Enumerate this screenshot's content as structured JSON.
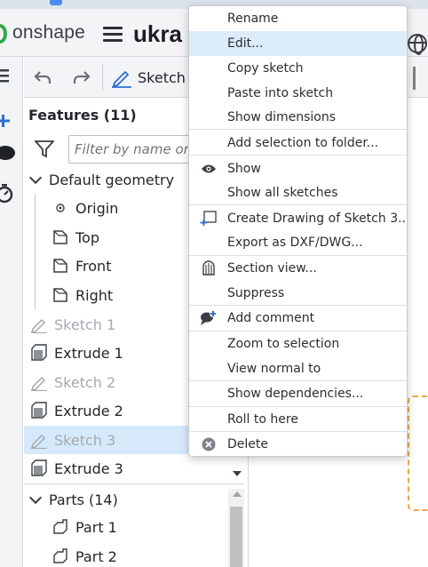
{
  "app": {
    "brand": "onshape",
    "doc_title": "ukra"
  },
  "toolbar": {
    "sketch_label": "Sketch"
  },
  "features": {
    "header": "Features (11)",
    "filter_placeholder": "Filter by name or t",
    "default_geometry_label": "Default geometry",
    "origin_label": "Origin",
    "planes": [
      "Top",
      "Front",
      "Right"
    ],
    "items": [
      {
        "label": "Sketch 1",
        "type": "sketch",
        "state": "greyed"
      },
      {
        "label": "Extrude 1",
        "type": "extrude",
        "state": "normal"
      },
      {
        "label": "Sketch 2",
        "type": "sketch",
        "state": "greyed"
      },
      {
        "label": "Extrude 2",
        "type": "extrude",
        "state": "normal"
      },
      {
        "label": "Sketch 3",
        "type": "sketch",
        "state": "selected"
      },
      {
        "label": "Extrude 3",
        "type": "extrude",
        "state": "normal"
      }
    ],
    "parts_header": "Parts (14)",
    "parts": [
      "Part 1",
      "Part 2"
    ]
  },
  "context_menu": {
    "items": {
      "rename": "Rename",
      "edit": "Edit...",
      "copy_sketch": "Copy sketch",
      "paste_into_sketch": "Paste into sketch",
      "show_dimensions": "Show dimensions",
      "add_selection_to_folder": "Add selection to folder...",
      "show": "Show",
      "show_all_sketches": "Show all sketches",
      "create_drawing": "Create Drawing of Sketch 3...",
      "export_dxf": "Export as DXF/DWG...",
      "section_view": "Section view...",
      "suppress": "Suppress",
      "add_comment": "Add comment",
      "zoom_to_selection": "Zoom to selection",
      "view_normal_to": "View normal to",
      "show_dependencies": "Show dependencies...",
      "roll_to_here": "Roll to here",
      "delete": "Delete"
    },
    "hovered": "edit"
  },
  "colors": {
    "brand_green": "#35a84a",
    "selection_blue": "#d6e9fb",
    "menu_hover": "#dcecf9",
    "sketch_orange": "#f2a641"
  }
}
